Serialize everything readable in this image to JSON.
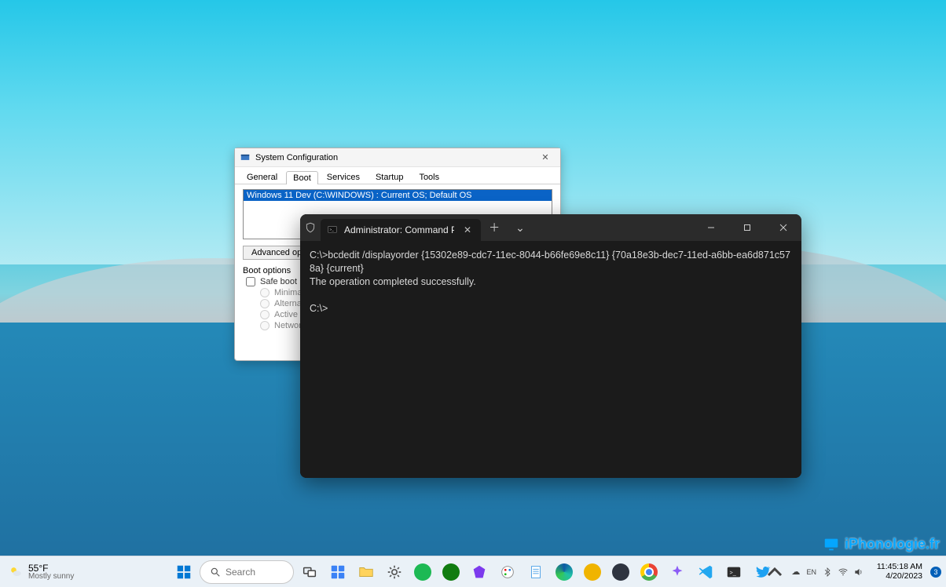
{
  "msconfig": {
    "window_title": "System Configuration",
    "tabs": {
      "general": "General",
      "boot": "Boot",
      "services": "Services",
      "startup": "Startup",
      "tools": "Tools"
    },
    "boot_entry": "Windows 11 Dev (C:\\WINDOWS) : Current OS; Default OS",
    "advanced_button": "Advanced opt",
    "boot_group_label": "Boot options",
    "safe_boot": "Safe boot",
    "minimal": "Minimal",
    "alternate": "Alternat",
    "active": "Active D",
    "network": "Networ"
  },
  "terminal": {
    "tab_title": "Administrator: Command Pro",
    "line1": "C:\\>bcdedit /displayorder {15302e89-cdc7-11ec-8044-b66fe69e8c11} {70a18e3b-dec7-11ed-a6bb-ea6d871c578a} {current}",
    "line2": "The operation completed successfully.",
    "line3": "",
    "prompt": "C:\\>"
  },
  "taskbar": {
    "weather_temp": "55°F",
    "weather_cond": "Mostly sunny",
    "search_placeholder": "Search",
    "clock_time": "11:45:18 AM",
    "clock_date": "4/20/2023",
    "notif_count": "3"
  },
  "watermark": "iPhonologie.fr"
}
